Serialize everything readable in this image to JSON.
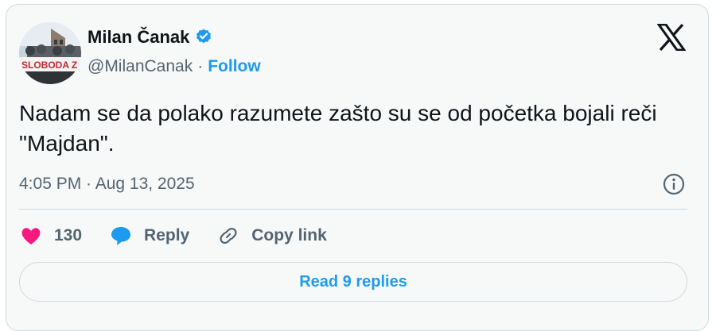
{
  "author": {
    "name": "Milan Čanak",
    "handle": "@MilanCanak",
    "separator": "·",
    "follow_label": "Follow",
    "verified": true,
    "avatar_banner_text": "SLOBODA ZA MA"
  },
  "tweet": {
    "text": "Nadam se da polako razumete zašto su se od početka bojali reči \"Majdan\".",
    "timestamp": "4:05 PM · Aug 13, 2025"
  },
  "actions": {
    "like_count": "130",
    "reply_label": "Reply",
    "copy_link_label": "Copy link"
  },
  "read_replies_label": "Read 9 replies",
  "colors": {
    "accent": "#1d9bf0",
    "heart": "#f91880",
    "muted": "#536471",
    "card_bg": "#f7f9f9"
  },
  "icons": [
    "verified-badge-icon",
    "x-logo-icon",
    "info-icon",
    "heart-icon",
    "reply-bubble-icon",
    "link-icon"
  ]
}
